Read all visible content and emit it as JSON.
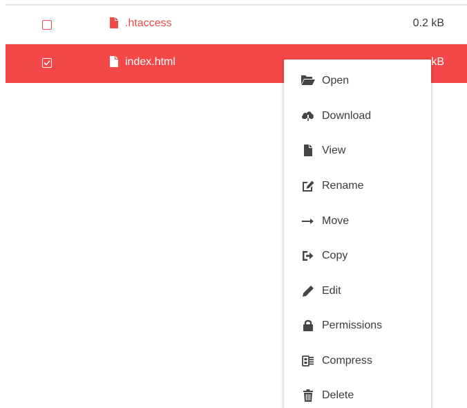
{
  "files": [
    {
      "name": ".htaccess",
      "size": "0.2 kB",
      "selected": false
    },
    {
      "name": "index.html",
      "size": "kB",
      "selected": true
    }
  ],
  "context_menu": {
    "items": [
      {
        "label": "Open",
        "icon": "folder-open-icon"
      },
      {
        "label": "Download",
        "icon": "cloud-download-icon"
      },
      {
        "label": "View",
        "icon": "file-icon"
      },
      {
        "label": "Rename",
        "icon": "edit-square-icon"
      },
      {
        "label": "Move",
        "icon": "arrow-right-icon"
      },
      {
        "label": "Copy",
        "icon": "sign-out-icon"
      },
      {
        "label": "Edit",
        "icon": "pencil-icon"
      },
      {
        "label": "Permissions",
        "icon": "lock-icon"
      },
      {
        "label": "Compress",
        "icon": "compress-archive-icon"
      },
      {
        "label": "Delete",
        "icon": "trash-icon"
      }
    ]
  },
  "colors": {
    "accent": "#f44848",
    "text": "#3c3c3c",
    "divider": "#e6e6e6"
  }
}
